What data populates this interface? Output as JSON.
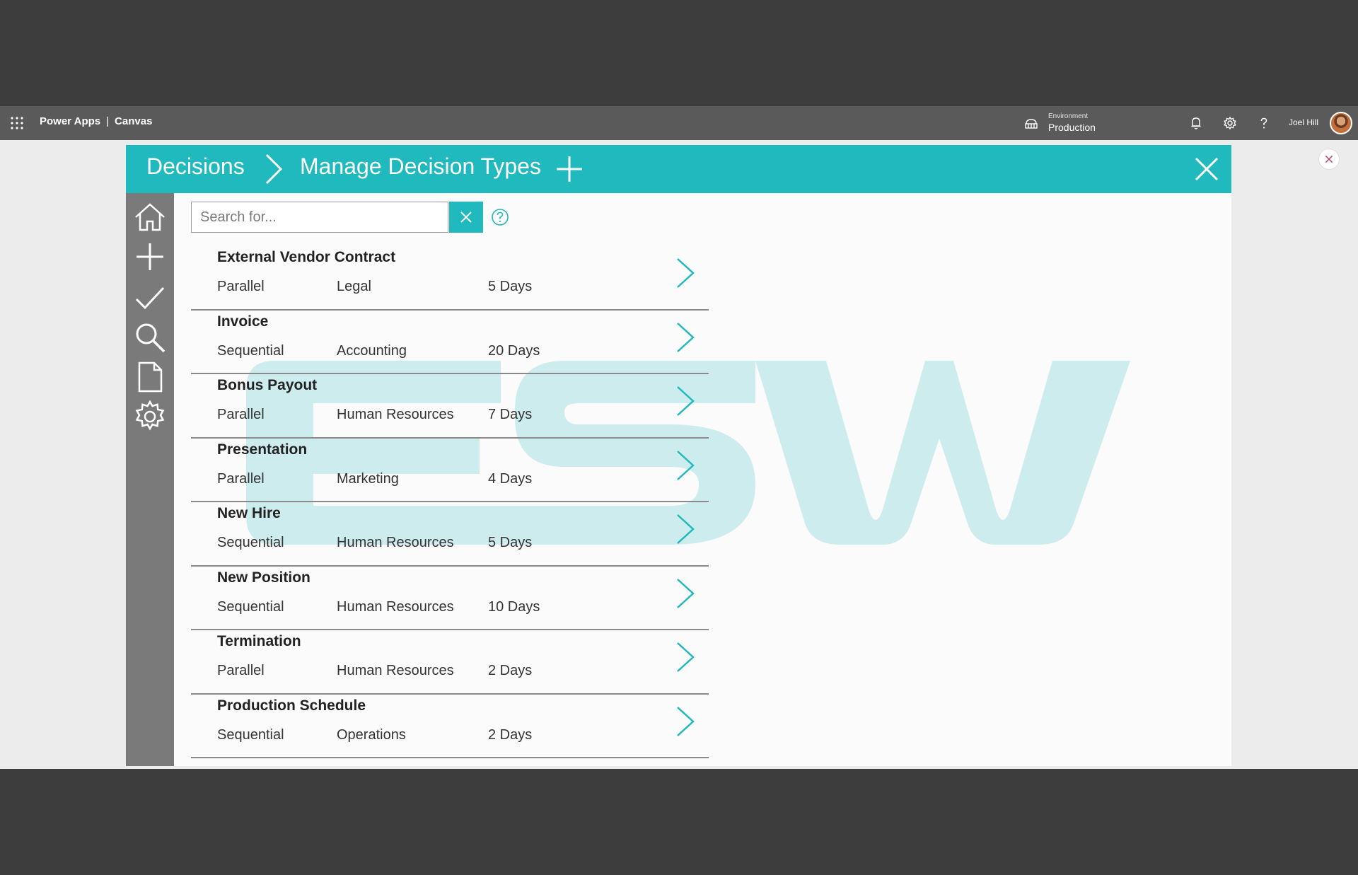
{
  "header": {
    "app_name": "Power Apps",
    "separator": "|",
    "section": "Canvas",
    "environment_label": "Environment",
    "environment_value": "Production",
    "user_name": "Joel Hill",
    "icons": [
      "waffle-icon",
      "environment-icon",
      "bell-icon",
      "gear-icon",
      "help-icon",
      "avatar"
    ]
  },
  "app": {
    "breadcrumb": [
      "Decisions",
      "Manage Decision Types"
    ],
    "accent_color": "#1fb9be",
    "nav_icons": [
      "home-icon",
      "plus-icon",
      "check-icon",
      "search-icon",
      "document-icon",
      "gear-icon"
    ],
    "search": {
      "placeholder": "Search for...",
      "value": ""
    },
    "decision_types": [
      {
        "name": "External Vendor Contract",
        "mode": "Parallel",
        "department": "Legal",
        "duration": "5 Days"
      },
      {
        "name": "Invoice",
        "mode": "Sequential",
        "department": "Accounting",
        "duration": "20 Days"
      },
      {
        "name": "Bonus Payout",
        "mode": "Parallel",
        "department": "Human Resources",
        "duration": "7 Days"
      },
      {
        "name": "Presentation",
        "mode": "Parallel",
        "department": "Marketing",
        "duration": "4 Days"
      },
      {
        "name": "New Hire",
        "mode": "Sequential",
        "department": "Human Resources",
        "duration": "5 Days"
      },
      {
        "name": "New Position",
        "mode": "Sequential",
        "department": "Human Resources",
        "duration": "10 Days"
      },
      {
        "name": "Termination",
        "mode": "Parallel",
        "department": "Human Resources",
        "duration": "2 Days"
      },
      {
        "name": "Production Schedule",
        "mode": "Sequential",
        "department": "Operations",
        "duration": "2 Days"
      }
    ]
  }
}
